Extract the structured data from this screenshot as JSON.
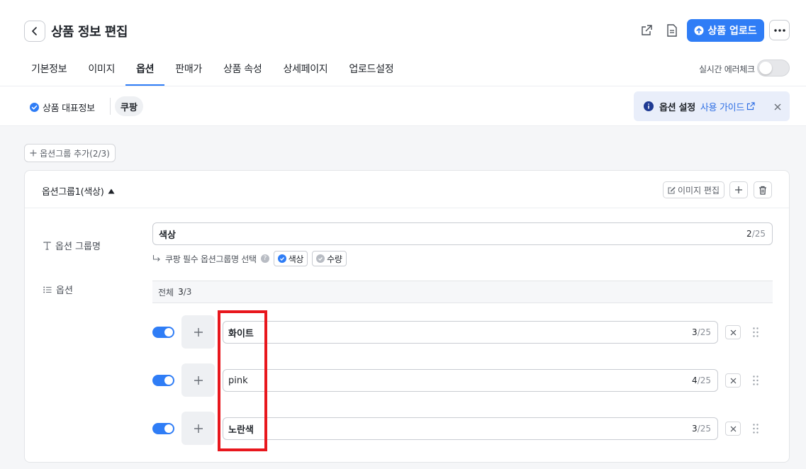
{
  "header": {
    "title": "상품 정보 편집",
    "upload_label": "상품 업로드"
  },
  "tabs": [
    {
      "label": "기본정보"
    },
    {
      "label": "이미지"
    },
    {
      "label": "옵션"
    },
    {
      "label": "판매가"
    },
    {
      "label": "상품 속성"
    },
    {
      "label": "상세페이지"
    },
    {
      "label": "업로드설정"
    }
  ],
  "active_tab": "옵션",
  "realtime_check": {
    "label": "실시간 에러체크",
    "enabled": false
  },
  "subbar": {
    "rep_info": "상품 대표정보",
    "market": "쿠팡",
    "guide_title": "옵션 설정",
    "guide_link": "사용 가이드"
  },
  "add_group_label": "옵션그룹 추가(2/3)",
  "group": {
    "title": "옵션그룹1(색상)",
    "image_edit_label": "이미지 편집",
    "name_label": "옵션 그룹명",
    "name_value": "색상",
    "name_count": "2",
    "name_max": "/25",
    "mandatory_label": "쿠팡 필수 옵션그룹명 선택",
    "mandatory_choices": [
      {
        "label": "색상",
        "selected": true
      },
      {
        "label": "수량",
        "selected": false
      }
    ],
    "options_label": "옵션",
    "total_label": "전체",
    "total_count": "3",
    "total_max": "/3"
  },
  "options": [
    {
      "value": "화이트",
      "count": "3",
      "max": "/25",
      "enabled": true
    },
    {
      "value": "pink",
      "count": "4",
      "max": "/25",
      "enabled": true
    },
    {
      "value": "노란색",
      "count": "3",
      "max": "/25",
      "enabled": true
    }
  ],
  "colors": {
    "accent": "#2f7df6",
    "highlight": "#e8171d"
  }
}
